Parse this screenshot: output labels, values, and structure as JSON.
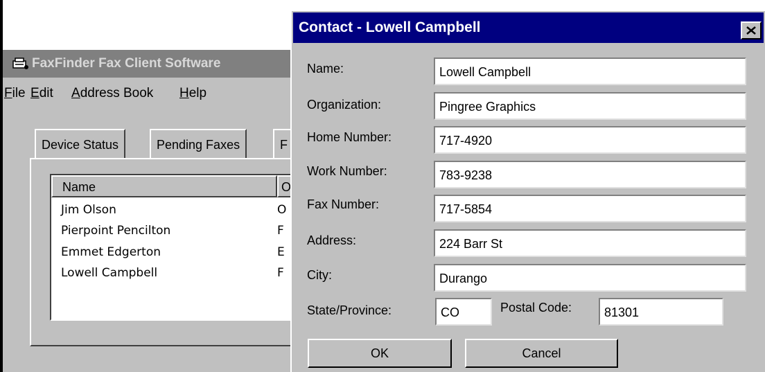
{
  "main_window": {
    "title": "FaxFinder Fax Client Software",
    "menu": [
      "File",
      "Edit",
      "Address Book",
      "Help"
    ],
    "menu_mnemonics": [
      "F",
      "E",
      "A",
      "H"
    ],
    "tabs": [
      "Device Status",
      "Pending Faxes",
      "F"
    ],
    "list": {
      "columns": [
        "Name",
        "O"
      ],
      "rows": [
        {
          "name": "Jim Olson",
          "col2": "O"
        },
        {
          "name": "Pierpoint Pencilton",
          "col2": "F"
        },
        {
          "name": "Emmet Edgerton",
          "col2": "E"
        },
        {
          "name": "Lowell Campbell",
          "col2": "F"
        }
      ]
    }
  },
  "dialog": {
    "title": "Contact - Lowell Campbell",
    "fields": {
      "name": {
        "label": "Name:",
        "value": "Lowell Campbell"
      },
      "organization": {
        "label": "Organization:",
        "value": "Pingree Graphics"
      },
      "home": {
        "label": "Home Number:",
        "value": "717-4920"
      },
      "work": {
        "label": "Work Number:",
        "value": "783-9238"
      },
      "fax": {
        "label": "Fax Number:",
        "value": "717-5854"
      },
      "address": {
        "label": "Address:",
        "value": "224 Barr St"
      },
      "city": {
        "label": "City:",
        "value": "Durango"
      },
      "state": {
        "label": "State/Province:",
        "value": "CO"
      },
      "postal": {
        "label": "Postal Code:",
        "value": "81301"
      }
    },
    "buttons": {
      "ok": "OK",
      "cancel": "Cancel"
    }
  },
  "colors": {
    "titlebar_active": "#000080",
    "titlebar_inactive": "#808080",
    "face": "#c0c0c0"
  }
}
